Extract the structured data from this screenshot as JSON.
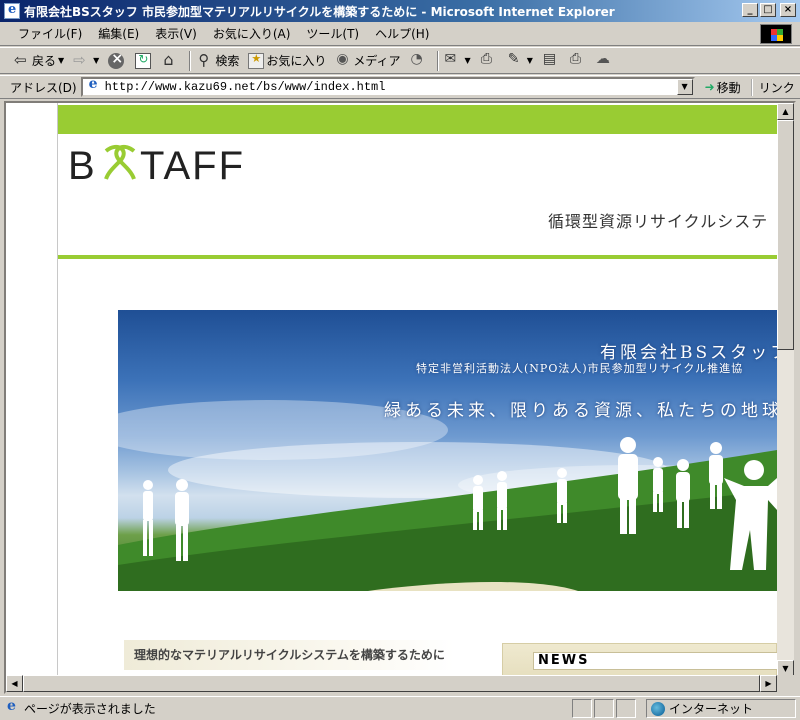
{
  "window": {
    "title": "有限会社BSスタッフ 市民参加型マテリアルリサイクルを構築するために - Microsoft Internet Explorer",
    "min_glyph": "_",
    "max_glyph": "□",
    "close_glyph": "×"
  },
  "menu": {
    "items": [
      "ファイル(F)",
      "編集(E)",
      "表示(V)",
      "お気に入り(A)",
      "ツール(T)",
      "ヘルプ(H)"
    ]
  },
  "toolbar": {
    "back": "戻る",
    "search": "検索",
    "favorites": "お気に入り",
    "media": "メディア"
  },
  "address": {
    "label": "アドレス(D)",
    "url": "http://www.kazu69.net/bs/www/index.html",
    "go": "移動",
    "links": "リンク"
  },
  "page": {
    "logo_text": "BSSTAFF",
    "tagline": "循環型資源リサイクルシステ",
    "banner": {
      "title": "有限会社BSスタッフ",
      "subtitle": "特定非営利活動法人(NPO法人)市民参加型リサイクル推進協",
      "slogan": "緑ある未来、限りある資源、私たちの地球"
    },
    "subheading": "理想的なマテリアルリサイクルシステムを構築するために",
    "news_label": "NEWS",
    "colors": {
      "accent_green": "#99cc33",
      "sky_blue": "#3c72b8",
      "grass_green": "#2f6d1f"
    }
  },
  "status": {
    "text": "ページが表示されました",
    "zone": "インターネット"
  }
}
